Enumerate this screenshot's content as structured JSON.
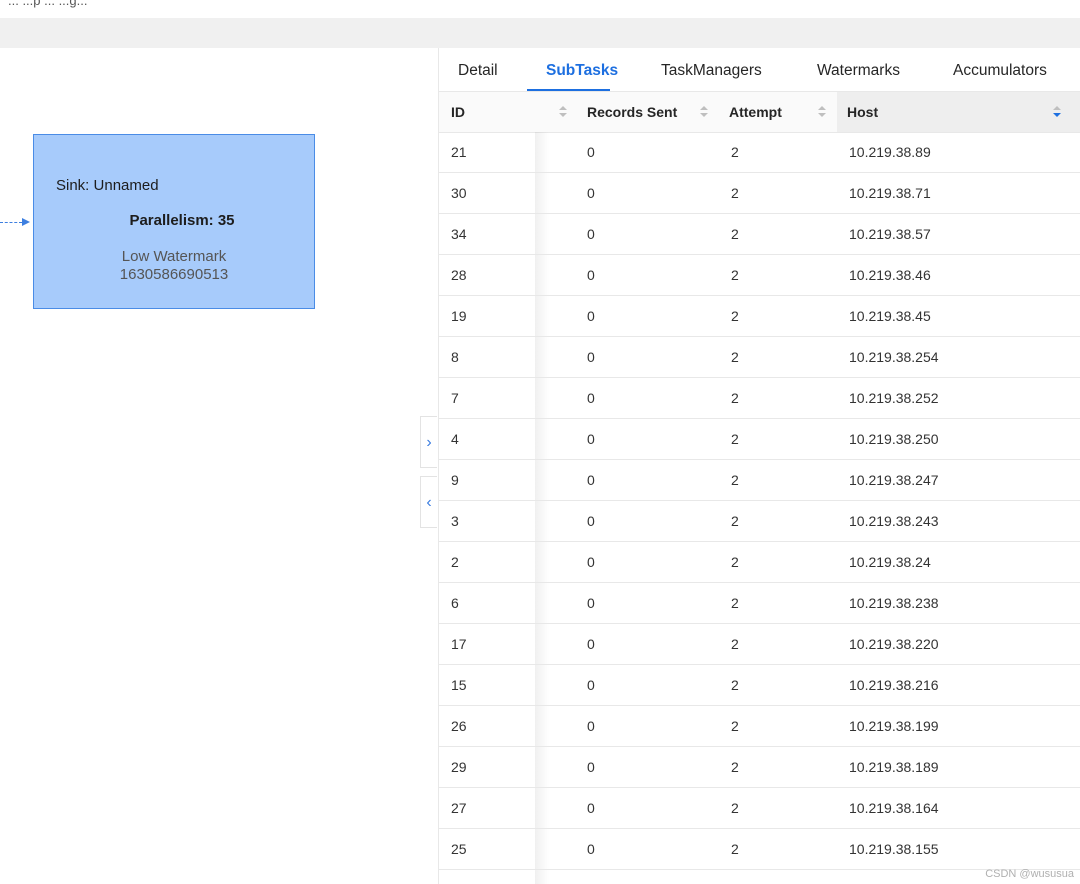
{
  "topbar": {
    "text": "... ...p ... ...g..."
  },
  "graph": {
    "node": {
      "title": "Sink: Unnamed",
      "parallelism": "Parallelism: 35",
      "low_watermark_label": "Low Watermark",
      "low_watermark_value": "1630586690513"
    }
  },
  "panel_toggles": {
    "expand": "›",
    "collapse": "‹"
  },
  "tabs": [
    {
      "label": "Detail"
    },
    {
      "label": "SubTasks",
      "active": true
    },
    {
      "label": "TaskManagers"
    },
    {
      "label": "Watermarks"
    },
    {
      "label": "Accumulators"
    }
  ],
  "table": {
    "columns": [
      "ID",
      "Records Sent",
      "Attempt",
      "Host"
    ],
    "sorted_column": "Host",
    "rows": [
      [
        "21",
        "0",
        "2",
        "10.219.38.89"
      ],
      [
        "30",
        "0",
        "2",
        "10.219.38.71"
      ],
      [
        "34",
        "0",
        "2",
        "10.219.38.57"
      ],
      [
        "28",
        "0",
        "2",
        "10.219.38.46"
      ],
      [
        "19",
        "0",
        "2",
        "10.219.38.45"
      ],
      [
        "8",
        "0",
        "2",
        "10.219.38.254"
      ],
      [
        "7",
        "0",
        "2",
        "10.219.38.252"
      ],
      [
        "4",
        "0",
        "2",
        "10.219.38.250"
      ],
      [
        "9",
        "0",
        "2",
        "10.219.38.247"
      ],
      [
        "3",
        "0",
        "2",
        "10.219.38.243"
      ],
      [
        "2",
        "0",
        "2",
        "10.219.38.24"
      ],
      [
        "6",
        "0",
        "2",
        "10.219.38.238"
      ],
      [
        "17",
        "0",
        "2",
        "10.219.38.220"
      ],
      [
        "15",
        "0",
        "2",
        "10.219.38.216"
      ],
      [
        "26",
        "0",
        "2",
        "10.219.38.199"
      ],
      [
        "29",
        "0",
        "2",
        "10.219.38.189"
      ],
      [
        "27",
        "0",
        "2",
        "10.219.38.164"
      ],
      [
        "25",
        "0",
        "2",
        "10.219.38.155"
      ]
    ]
  },
  "colors": {
    "accent": "#1d6fe0",
    "node_fill": "#a7cbfb",
    "node_border": "#4a8ce6"
  },
  "watermark": "CSDN @wususua"
}
